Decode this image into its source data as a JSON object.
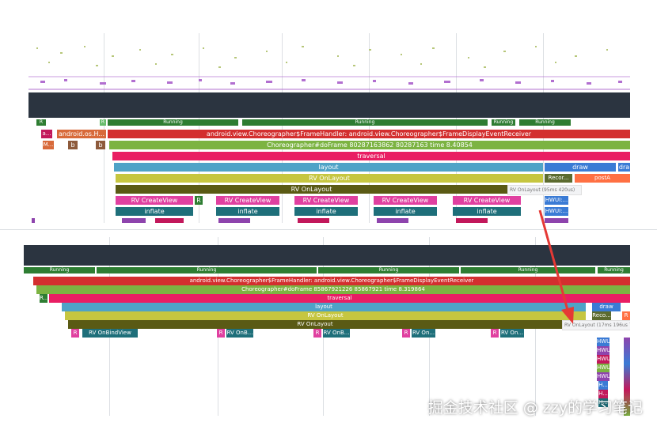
{
  "top": {
    "states": [
      "R",
      "R",
      "Running",
      "Running",
      "Running",
      "Running"
    ],
    "slices": {
      "looper_short": "a...",
      "looper_handler": "android.os.H...",
      "frame_handler": "android.view.Choreographer$FrameHandler: android.view.Choreographer$FrameDisplayEventReceiver",
      "do_frame": "Choreographer#doFrame 80287163862 80287163 time 8.40854",
      "traversal": "traversal",
      "layout": "layout",
      "draw": "draw",
      "draw2": "dra",
      "rv_onlayout_1": "RV OnLayout",
      "rv_onlayout_2": "RV OnLayout",
      "record": "Recor...",
      "post": "postA",
      "tooltip": "RV OnLayout (95ms 420us)",
      "mini": [
        "M...",
        "b",
        "b"
      ],
      "rv_create": [
        "RV CreateView",
        "RV CreateView",
        "RV CreateView",
        "RV CreateView",
        "RV CreateView",
        "RV CreateView"
      ],
      "r_label": "R",
      "inflate": [
        "inflate",
        "inflate",
        "inflate",
        "inflate",
        "inflate",
        "inflate"
      ],
      "hwui": [
        "HWUI:...",
        "HWUI:..."
      ]
    }
  },
  "bottom": {
    "states": [
      "Running",
      "Running",
      "Running",
      "Running",
      "Running"
    ],
    "slices": {
      "frame_handler": "android.view.Choreographer$FrameHandler: android.view.Choreographer$FrameDisplayEventReceiver",
      "do_frame": "Choreographer#doFrame 85867921226 85867921 time 8.319864",
      "traversal": "traversal",
      "layout": "layout",
      "draw": "draw",
      "rv_onlayout_1": "RV OnLayout",
      "rv_onlayout_2": "RV OnLayout",
      "record": "Reco...",
      "r_right": "R",
      "tooltip": "RV OnLayout (17ms 196us 768ns)",
      "r_labels": [
        "R...",
        "R",
        "R",
        "R",
        "R",
        "R"
      ],
      "bind": [
        "RV OnBindView",
        "RV OnB...",
        "RV OnB...",
        "RV On...",
        "RV On..."
      ],
      "hwui": [
        "HWU...",
        "HWU...",
        "HWU...",
        "HWU...",
        "HWU...",
        "H...",
        "H...",
        "H..."
      ]
    }
  },
  "watermark": "掘金技术社区 @ zzy的学习笔记",
  "colors": {
    "running": "#2e7d32",
    "handler": "#d32f2f",
    "do_frame": "#7cb342",
    "traversal": "#e91e63",
    "layout": "#4fa3c7",
    "rv_onlayout": "#c6c640",
    "rv_onlayout_dark": "#5a5a14",
    "create": "#e040a0",
    "inflate": "#1e6f7a",
    "arrow": "#e53935"
  }
}
